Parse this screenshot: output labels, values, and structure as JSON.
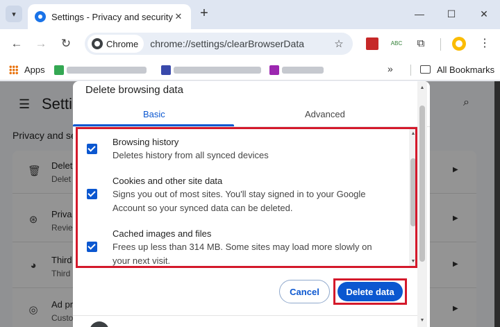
{
  "tab": {
    "title": "Settings - Privacy and security",
    "close": "✕",
    "new_tab": "+"
  },
  "window": {
    "minimize": "—",
    "maximize": "☐",
    "close": "✕"
  },
  "omnibox": {
    "chip_label": "Chrome",
    "url": "chrome://settings/clearBrowserData"
  },
  "bookmarks": {
    "apps": "Apps",
    "more": "»",
    "all_bookmarks": "All Bookmarks"
  },
  "settings_page": {
    "title": "Setti",
    "section": "Privacy and se",
    "rows": [
      {
        "icon": "trash-icon",
        "line1": "Delet",
        "line2": "Delet"
      },
      {
        "icon": "compass-icon",
        "line1": "Priva",
        "line2": "Revie"
      },
      {
        "icon": "cookie-icon",
        "line1": "Third",
        "line2": "Third"
      },
      {
        "icon": "ad-icon",
        "line1": "Ad pr",
        "line2": "Custo"
      }
    ]
  },
  "dialog": {
    "title": "Delete browsing data",
    "tabs": {
      "basic": "Basic",
      "advanced": "Advanced"
    },
    "items": [
      {
        "title": "Browsing history",
        "description": "Deletes history from all synced devices",
        "checked": true
      },
      {
        "title": "Cookies and other site data",
        "description": "Signs you out of most sites. You'll stay signed in to your Google Account so your synced data can be deleted.",
        "checked": true
      },
      {
        "title": "Cached images and files",
        "description": "Frees up less than 314 MB. Some sites may load more slowly on your next visit.",
        "checked": true
      }
    ],
    "cancel": "Cancel",
    "delete": "Delete data"
  },
  "colors": {
    "accent": "#0b57d0",
    "highlight": "#d4192b"
  }
}
